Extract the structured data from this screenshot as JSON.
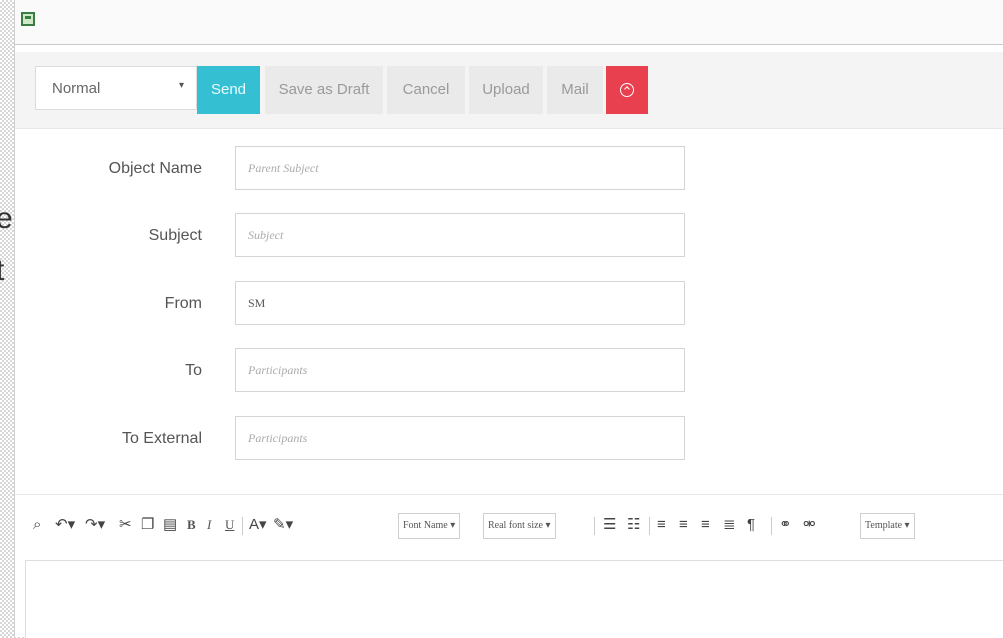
{
  "background_fragments": [
    "e",
    "t"
  ],
  "window": {
    "icon": "app-window-icon"
  },
  "toolbar": {
    "priority_select": {
      "value": "Normal",
      "caret": "▾"
    },
    "send_label": "Send",
    "save_draft_label": "Save as Draft",
    "cancel_label": "Cancel",
    "upload_label": "Upload",
    "mail_label": "Mail",
    "danger_icon": "arrow-up-circle-icon",
    "colors": {
      "send": "#35bfd3",
      "danger": "#e8404f"
    }
  },
  "form": {
    "object_name": {
      "label": "Object Name",
      "placeholder": "Parent Subject"
    },
    "subject": {
      "label": "Subject",
      "placeholder": "Subject"
    },
    "from": {
      "label": "From",
      "value": "SM"
    },
    "to": {
      "label": "To",
      "placeholder": "Participants"
    },
    "to_external": {
      "label": "To External",
      "placeholder": "Participants"
    }
  },
  "editor": {
    "icons": [
      "binoculars-icon",
      "undo-icon",
      "redo-icon",
      "cut-icon",
      "copy-icon",
      "paste-icon",
      "bold-icon",
      "italic-icon",
      "underline-icon",
      "font-color-icon",
      "highlight-icon",
      "bullet-list-icon",
      "numbered-list-icon",
      "align-left-icon",
      "align-center-icon",
      "align-right-icon",
      "align-justify-icon",
      "paragraph-icon",
      "link-icon",
      "unlink-icon"
    ],
    "bold": "B",
    "italic": "I",
    "underline": "U",
    "font_name": "Font Name ▾",
    "font_size": "Real font size ▾",
    "template": "Template  ▾"
  }
}
